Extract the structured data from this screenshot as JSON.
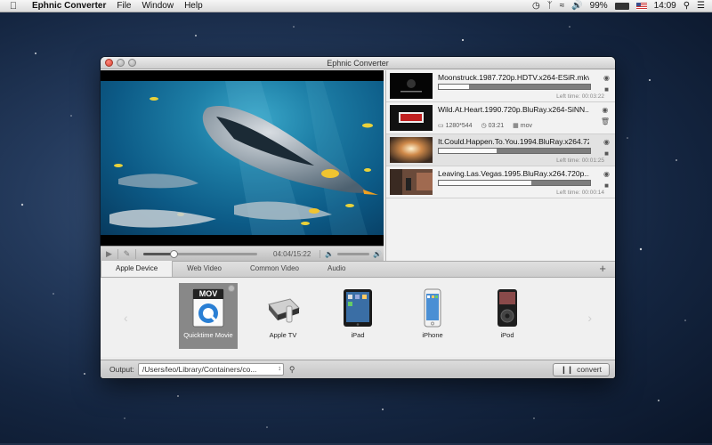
{
  "menubar": {
    "app_name": "Ephnic Converter",
    "menus": [
      "File",
      "Window",
      "Help"
    ],
    "battery": "99%",
    "clock": "14:09"
  },
  "window": {
    "title": "Ephnic Converter"
  },
  "player": {
    "time": "04:04/15:22",
    "progress": 0.265
  },
  "queue": [
    {
      "name": "Moonstruck.1987.720p.HDTV.x264-ESiR.mkv",
      "left_label": "Left time:",
      "left_time": "00:03:22",
      "progress": 0.2
    },
    {
      "name": "Wild.At.Heart.1990.720p.BluRay.x264-SiNN...",
      "resolution": "1280*544",
      "duration": "03:21",
      "format": "mov"
    },
    {
      "name": "It.Could.Happen.To.You.1994.BluRay.x264.720p...",
      "left_label": "Left time:",
      "left_time": "00:01:25",
      "progress": 0.38
    },
    {
      "name": "Leaving.Las.Vegas.1995.BluRay.x264.720p...",
      "left_label": "Left time:",
      "left_time": "00:00:14",
      "progress": 0.61
    }
  ],
  "tabs": [
    "Apple Device",
    "Web Video",
    "Common Video",
    "Audio"
  ],
  "devices": [
    {
      "label": "Quicktime Movie",
      "icon": "quicktime-mov-icon",
      "badge": "MOV"
    },
    {
      "label": "Apple TV",
      "icon": "apple-tv-icon"
    },
    {
      "label": "iPad",
      "icon": "ipad-icon"
    },
    {
      "label": "iPhone",
      "icon": "iphone-icon"
    },
    {
      "label": "iPod",
      "icon": "ipod-icon"
    }
  ],
  "bottom": {
    "output_label": "Output:",
    "output_path": "/Users/leo/Library/Containers/co...",
    "convert_label": "convert"
  }
}
